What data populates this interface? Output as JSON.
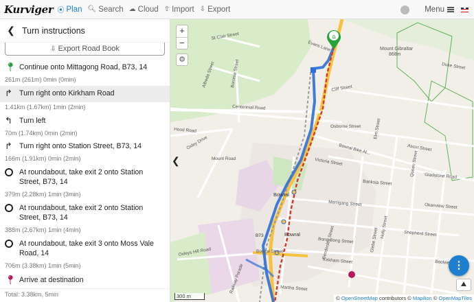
{
  "navbar": {
    "brand": "Kurviger",
    "items": [
      {
        "label": "Plan",
        "icon": "map-marker-icon",
        "active": true
      },
      {
        "label": "Search",
        "icon": "search-icon",
        "active": false
      },
      {
        "label": "Cloud",
        "icon": "cloud-icon",
        "active": false
      },
      {
        "label": "Import",
        "icon": "upload-icon",
        "active": false
      },
      {
        "label": "Export",
        "icon": "download-icon",
        "active": false
      }
    ],
    "menu_label": "Menu",
    "accent_color": "#1e7fd0"
  },
  "panel": {
    "title": "Turn instructions",
    "export_label": "Export Road Book",
    "instructions": [
      {
        "icon": "start-pin-icon",
        "text": "Continue onto Mittagong Road, B73, 14",
        "meta": "261m (261m) 0min (0min)"
      },
      {
        "icon": "turn-right-icon",
        "text": "Turn right onto Kirkham Road",
        "meta": "1.41km (1.67km) 1min (2min)"
      },
      {
        "icon": "turn-left-icon",
        "text": "Turn left",
        "meta": "70m (1.74km) 0min (2min)"
      },
      {
        "icon": "turn-right-icon",
        "text": "Turn right onto Station Street, B73, 14",
        "meta": "166m (1.91km) 0min (2min)"
      },
      {
        "icon": "roundabout-icon",
        "text": "At roundabout, take exit 2 onto Station Street, B73, 14",
        "meta": "379m (2.28km) 1min (3min)"
      },
      {
        "icon": "roundabout-icon",
        "text": "At roundabout, take exit 2 onto Station Street, B73, 14",
        "meta": "388m (2.67km) 1min (4min)"
      },
      {
        "icon": "roundabout-icon",
        "text": "At roundabout, take exit 3 onto Moss Vale Road, 14",
        "meta": "706m (3.38km) 1min (5min)"
      },
      {
        "icon": "destination-pin-icon",
        "text": "Arrive at destination",
        "meta": ""
      }
    ],
    "total": "Total: 3.38km, 5min"
  },
  "map": {
    "zoom_in": "+",
    "zoom_out": "−",
    "scale_label": "300 m",
    "attribution": {
      "prefix": "©",
      "osm": "OpenStreetMap",
      "contributors": "contributors ©",
      "mapilion": "Mapilion",
      "sep": "©",
      "omt": "OpenMapTiles"
    },
    "labels": {
      "st_clair": "St Clair Street",
      "alfreda": "Alfreda Street",
      "boronia": "Boronia Street",
      "evans": "Evans Lane",
      "mount_gibraltar": "Mount Gibraltar",
      "mount_gibraltar_elev": "868m",
      "duke": "Duke Street",
      "cliff": "Cliff Street",
      "centennial": "Centennial Road",
      "osborne": "Osborne Street",
      "elm": "Elm Street",
      "oxley": "Oxley Drive",
      "bowral_lake": "Bowral Bike Al...",
      "ascot": "Ascot Street",
      "hood": "Hood Road",
      "mount": "Mount Road",
      "victoria": "Victoria Street",
      "gladstone": "Gladstone Road",
      "banksia": "Banksia Street",
      "queen": "Queen Street",
      "bowral": "Bowral",
      "bowral2": "Bowral",
      "merrigang": "Merrigang Street",
      "okanview": "Okanview Street",
      "shepherd": "Shepherd Street",
      "bendooley": "Bendooley Street",
      "holly": "Holly Street",
      "glebe": "Glebe Street",
      "oxleys_hill": "Oxleys Hill Road",
      "bowral_st": "Bowral Street",
      "bong_bong": "Bong Bong Street",
      "boolwey": "Boolwey Street",
      "kirkham": "Kirkham Street",
      "martha": "Martha Street",
      "b73": "B73",
      "railway": "Railway Parade"
    },
    "colors": {
      "route": "#2f6fd6",
      "alt_route": "#d53a2a",
      "main_road": "#f5c242",
      "green": "#cce8b9"
    }
  }
}
